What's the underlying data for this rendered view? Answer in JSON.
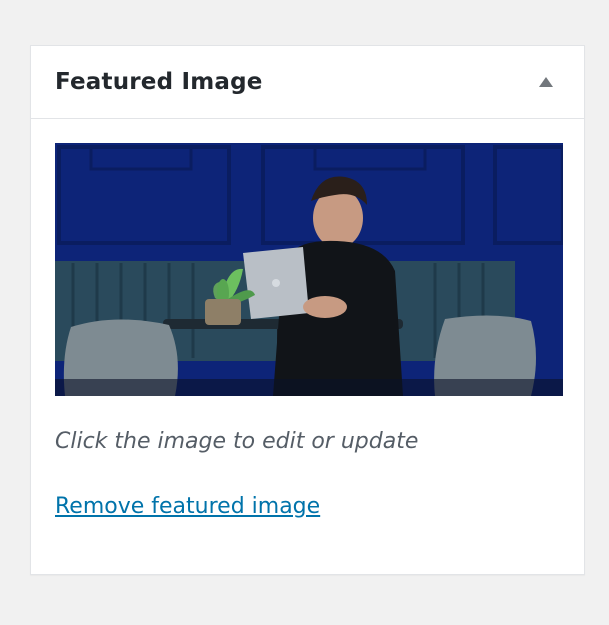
{
  "panel": {
    "title": "Featured Image",
    "toggle_icon": "triangle-up-icon"
  },
  "image": {
    "description_icon": "featured-photo"
  },
  "hint": "Click the image to edit or update",
  "remove_link": "Remove featured image",
  "colors": {
    "link": "#0073aa",
    "background": "#f1f1f1",
    "panel": "#ffffff",
    "wall_blue": "#0d2478"
  }
}
